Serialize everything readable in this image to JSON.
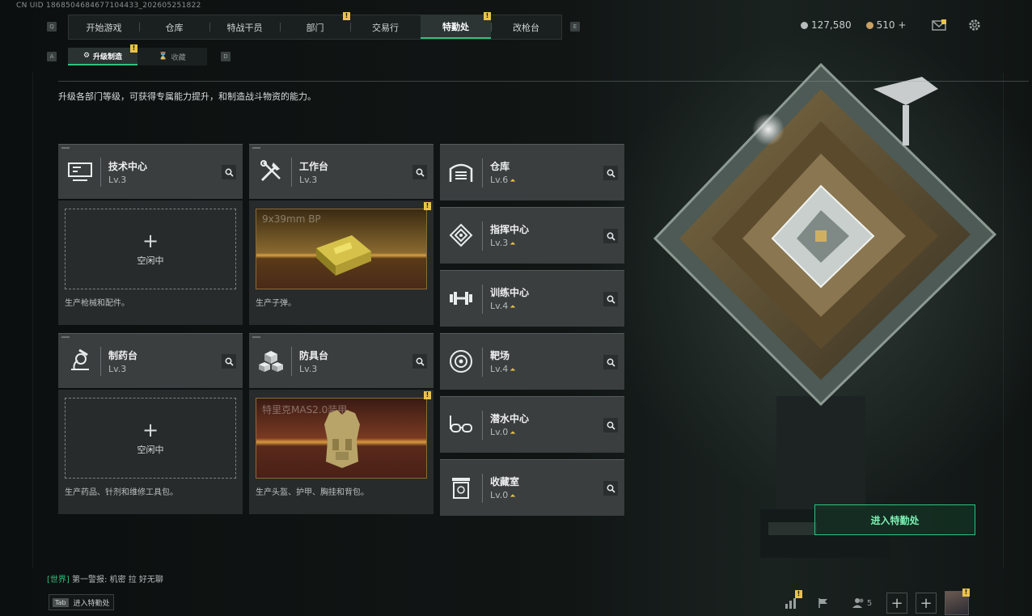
{
  "uid": "CN UID 1868504684677104433_202605251822",
  "nav": {
    "tabs": [
      {
        "label": "开始游戏"
      },
      {
        "label": "仓库"
      },
      {
        "label": "特战干员"
      },
      {
        "label": "部门"
      },
      {
        "label": "交易行"
      },
      {
        "label": "特勤处",
        "active": true
      },
      {
        "label": "改枪台"
      }
    ],
    "left_key": "Q",
    "right_key": "E"
  },
  "currency": {
    "silver": "127,580",
    "gold": "510",
    "plus": "+"
  },
  "subtabs": {
    "left_key": "A",
    "right_key": "D",
    "items": [
      {
        "label": "升级制造"
      },
      {
        "label": "收藏"
      }
    ]
  },
  "description": "升级各部门等级，可获得专属能力提升，和制造战斗物资的能力。",
  "main_departments": [
    {
      "name": "技术中心",
      "level": "Lv.3",
      "slot": {
        "state": "idle",
        "plus": "+",
        "label": "空闲中"
      },
      "desc": "生产枪械和配件。"
    },
    {
      "name": "工作台",
      "level": "Lv.3",
      "slot": {
        "state": "producing",
        "item": "9x39mm BP"
      },
      "desc": "生产子弹。"
    },
    {
      "name": "制药台",
      "level": "Lv.3",
      "slot": {
        "state": "idle",
        "plus": "+",
        "label": "空闲中"
      },
      "desc": "生产药品、针剂和维修工具包。"
    },
    {
      "name": "防具台",
      "level": "Lv.3",
      "slot": {
        "state": "producing",
        "item": "特里克MAS2.0装甲"
      },
      "desc": "生产头盔、护甲、胸挂和背包。"
    }
  ],
  "side_departments": [
    {
      "name": "仓库",
      "level": "Lv.6",
      "icon": "warehouse-icon"
    },
    {
      "name": "指挥中心",
      "level": "Lv.3",
      "icon": "chip-icon"
    },
    {
      "name": "训练中心",
      "level": "Lv.4",
      "icon": "dumbbell-icon"
    },
    {
      "name": "靶场",
      "level": "Lv.4",
      "icon": "target-icon"
    },
    {
      "name": "潜水中心",
      "level": "Lv.0",
      "icon": "diving-mask-icon"
    },
    {
      "name": "收藏室",
      "level": "Lv.0",
      "icon": "recycle-bin-icon"
    }
  ],
  "enter_button": "进入特勤处",
  "chat": {
    "channel": "[世界]",
    "message": "第一警报: 机密 拉 好无聊"
  },
  "tab_hint": {
    "key": "Tab",
    "label": "进入特勤处"
  },
  "bottom": {
    "friends_count": "5"
  },
  "colors": {
    "accent": "#2ec27e",
    "alert": "#e9c44a",
    "card": "#3a3e3f"
  }
}
